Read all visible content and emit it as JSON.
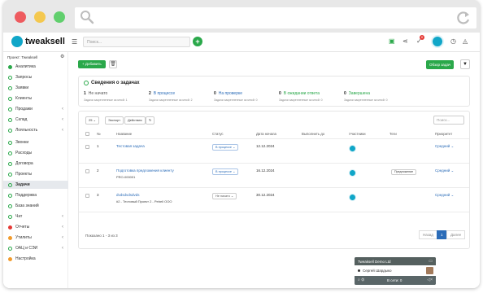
{
  "app": {
    "brand": "tweaksell",
    "search_placeholder": "Поиск...",
    "notification_count": "0",
    "project_label": "Проект: Tweaksell"
  },
  "sidebar": {
    "items": [
      {
        "label": "Аналитика",
        "icon": "dot-filled",
        "chevron": false
      },
      {
        "label": "Запросы",
        "icon": "dot",
        "chevron": false
      },
      {
        "label": "Заявки",
        "icon": "dot",
        "chevron": false
      },
      {
        "label": "Клиенты",
        "icon": "dot",
        "chevron": false
      },
      {
        "label": "Продажи",
        "icon": "dot",
        "chevron": true
      },
      {
        "label": "Склад",
        "icon": "dot",
        "chevron": true
      },
      {
        "label": "Лояльность",
        "icon": "dot",
        "chevron": true
      },
      {
        "label": "Звонки",
        "icon": "dot",
        "chevron": false
      },
      {
        "label": "Расходы",
        "icon": "dot",
        "chevron": false
      },
      {
        "label": "Договора",
        "icon": "dot",
        "chevron": false
      },
      {
        "label": "Проекты",
        "icon": "dot",
        "chevron": false
      },
      {
        "label": "Задачи",
        "icon": "dot",
        "chevron": false,
        "active": true
      },
      {
        "label": "Поддержка",
        "icon": "dot",
        "chevron": false
      },
      {
        "label": "База знаний",
        "icon": "dot",
        "chevron": false
      },
      {
        "label": "Чат",
        "icon": "dot",
        "chevron": true
      },
      {
        "label": "Отчеты",
        "icon": "dot-red",
        "chevron": true
      },
      {
        "label": "Утилиты",
        "icon": "dot-orange",
        "chevron": true
      },
      {
        "label": "ОАЦ и СЭИ",
        "icon": "dot",
        "chevron": true
      },
      {
        "label": "Настройка",
        "icon": "dot-orange",
        "chevron": false
      }
    ]
  },
  "toolbar": {
    "add_label": "+ Добавить",
    "overview_label": "Обзор задач"
  },
  "summary": {
    "title": "Сведения о задачах",
    "stats": [
      {
        "count": "1",
        "label": "Не начато",
        "sub": "Задачи закрепленные за мной: 1",
        "color": "gray"
      },
      {
        "count": "2",
        "label": "В процессе",
        "sub": "Задачи закрепленные за мной: 2",
        "color": "blue"
      },
      {
        "count": "0",
        "label": "На проверке",
        "sub": "Задачи закрепленные за мной: 0",
        "color": "blue"
      },
      {
        "count": "0",
        "label": "В ожидании ответа",
        "sub": "Задачи закрепленные за мной: 0",
        "color": "green"
      },
      {
        "count": "0",
        "label": "Завершена",
        "sub": "Задачи закрепленные за мной: 0",
        "color": "green"
      }
    ]
  },
  "table": {
    "page_size": "25",
    "export_label": "Экспорт",
    "actions_label": "Действия",
    "search_placeholder": "Поиск...",
    "columns": [
      "№",
      "Название",
      "Статус",
      "Дата начала",
      "Выполнить до",
      "Участники",
      "Теги",
      "Приоритет"
    ],
    "rows": [
      {
        "num": "1",
        "title": "Тестовая задача",
        "subtitle": "",
        "status": "В процессе",
        "status_style": "blue",
        "start": "12.12.2024",
        "due": "",
        "tag": "",
        "priority": "Средний"
      },
      {
        "num": "2",
        "title": "Подготовка предложения клиенту",
        "subtitle": "PRO-000001",
        "status": "В процессе",
        "status_style": "blue",
        "start": "16.12.2024",
        "due": "",
        "tag": "Предложение",
        "priority": "Средний"
      },
      {
        "num": "3",
        "title": "dvdsdvdsdvds",
        "subtitle": "#2 - Тестовый Проект 2 - Pebell ООО",
        "status": "Не начато",
        "status_style": "gray",
        "start": "30.12.2024",
        "due": "",
        "tag": "",
        "priority": "Средний"
      }
    ],
    "footer_info": "Показано 1 - 3 из 3",
    "prev_label": "Назад",
    "current_page": "1",
    "next_label": "Далее"
  },
  "chat": {
    "title": "Tweaksell Demo Ltd",
    "user": "Сергей Шардыко",
    "online": "В сети: 0"
  },
  "colors": {
    "accent_green": "#2aa84a",
    "link_blue": "#2b6cb8",
    "brand_teal": "#10a6c8"
  }
}
